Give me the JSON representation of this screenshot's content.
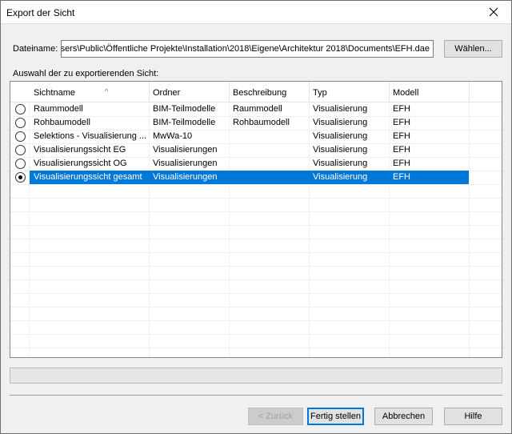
{
  "window": {
    "title": "Export der Sicht"
  },
  "file": {
    "label": "Dateiname:",
    "value": "C:\\Users\\Public\\Öffentliche Projekte\\Installation\\2018\\Eigene\\Architektur 2018\\Documents\\EFH.dae",
    "choose_label": "Wählen..."
  },
  "list": {
    "caption": "Auswahl der zu exportierenden Sicht:",
    "columns": [
      "Sichtname",
      "Ordner",
      "Beschreibung",
      "Typ",
      "Modell"
    ],
    "rows": [
      {
        "name": "Raummodell",
        "folder": "BIM-Teilmodelle",
        "description": "Raummodell",
        "type": "Visualisierung",
        "model": "EFH",
        "selected": false
      },
      {
        "name": "Rohbaumodell",
        "folder": "BIM-Teilmodelle",
        "description": "Rohbaumodell",
        "type": "Visualisierung",
        "model": "EFH",
        "selected": false
      },
      {
        "name": "Selektions - Visualisierung ...",
        "folder": "MwWa-10",
        "description": "",
        "type": "Visualisierung",
        "model": "EFH",
        "selected": false
      },
      {
        "name": "Visualisierungssicht EG",
        "folder": "Visualisierungen",
        "description": "",
        "type": "Visualisierung",
        "model": "EFH",
        "selected": false
      },
      {
        "name": "Visualisierungssicht OG",
        "folder": "Visualisierungen",
        "description": "",
        "type": "Visualisierung",
        "model": "EFH",
        "selected": false
      },
      {
        "name": "Visualisierungssicht gesamt",
        "folder": "Visualisierungen",
        "description": "",
        "type": "Visualisierung",
        "model": "EFH",
        "selected": true
      }
    ]
  },
  "buttons": {
    "back": "< Zurück",
    "finish": "Fertig stellen",
    "cancel": "Abbrechen",
    "help": "Hilfe"
  },
  "colors": {
    "selection": "#0078d7"
  },
  "icons": {
    "close": "close-icon",
    "sort": "sort-up-icon",
    "radio": "radio-button"
  }
}
